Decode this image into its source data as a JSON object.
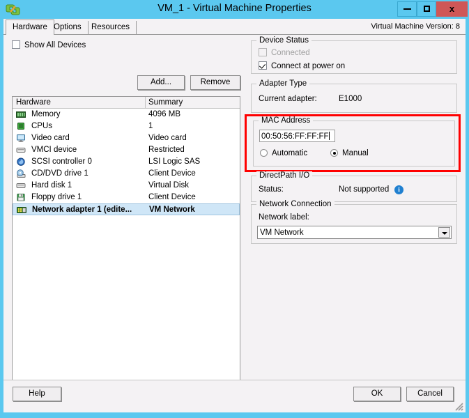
{
  "window": {
    "title": "VM_1 - Virtual Machine Properties",
    "icon": "vmware-vm-icon",
    "minimize_label": "",
    "maximize_label": "",
    "close_label": "x",
    "titlebar_color": "#5bc8ef",
    "close_button_color": "#cf5757"
  },
  "tabs": [
    {
      "label": "Hardware",
      "active": true
    },
    {
      "label": "Options",
      "active": false
    },
    {
      "label": "Resources",
      "active": false
    }
  ],
  "header": {
    "vm_version": "Virtual Machine Version: 8"
  },
  "left_pane": {
    "show_all_devices": {
      "label": "Show All Devices",
      "checked": false
    },
    "add_button": "Add...",
    "remove_button": "Remove",
    "list": {
      "columns": [
        "Hardware",
        "Summary"
      ],
      "rows": [
        {
          "icon": "memory-icon",
          "name": "Memory",
          "summary": "4096 MB",
          "selected": false
        },
        {
          "icon": "cpu-icon",
          "name": "CPUs",
          "summary": "1",
          "selected": false
        },
        {
          "icon": "video-card-icon",
          "name": "Video card",
          "summary": "Video card",
          "selected": false
        },
        {
          "icon": "vmci-device-icon",
          "name": "VMCI device",
          "summary": "Restricted",
          "selected": false
        },
        {
          "icon": "scsi-controller-icon",
          "name": "SCSI controller 0",
          "summary": "LSI Logic SAS",
          "selected": false
        },
        {
          "icon": "cd-dvd-drive-icon",
          "name": "CD/DVD drive 1",
          "summary": "Client Device",
          "selected": false
        },
        {
          "icon": "hard-disk-icon",
          "name": "Hard disk 1",
          "summary": "Virtual Disk",
          "selected": false
        },
        {
          "icon": "floppy-drive-icon",
          "name": "Floppy drive 1",
          "summary": "Client Device",
          "selected": false
        },
        {
          "icon": "network-adapter-icon",
          "name": "Network adapter 1 (edite...",
          "summary": "VM Network",
          "selected": true
        }
      ]
    }
  },
  "right_pane": {
    "device_status": {
      "title": "Device Status",
      "connected": {
        "label": "Connected",
        "checked": false,
        "disabled": true
      },
      "connect_at_power_on": {
        "label": "Connect at power on",
        "checked": true,
        "disabled": false
      }
    },
    "adapter_type": {
      "title": "Adapter Type",
      "current_adapter_label": "Current adapter:",
      "current_adapter_value": "E1000"
    },
    "mac_address": {
      "title": "MAC Address",
      "value": "00:50:56:FF:FF:FF",
      "mode_automatic": {
        "label": "Automatic",
        "checked": false
      },
      "mode_manual": {
        "label": "Manual",
        "checked": true
      },
      "highlight_color": "#ff0000"
    },
    "directpath_io": {
      "title": "DirectPath I/O",
      "status_label": "Status:",
      "status_value": "Not supported",
      "info_icon": "info-icon",
      "info_glyph": "i"
    },
    "network_connection": {
      "title": "Network Connection",
      "network_label_caption": "Network label:",
      "selected_network": "VM Network"
    }
  },
  "footer": {
    "help_button": "Help",
    "ok_button": "OK",
    "cancel_button": "Cancel"
  }
}
